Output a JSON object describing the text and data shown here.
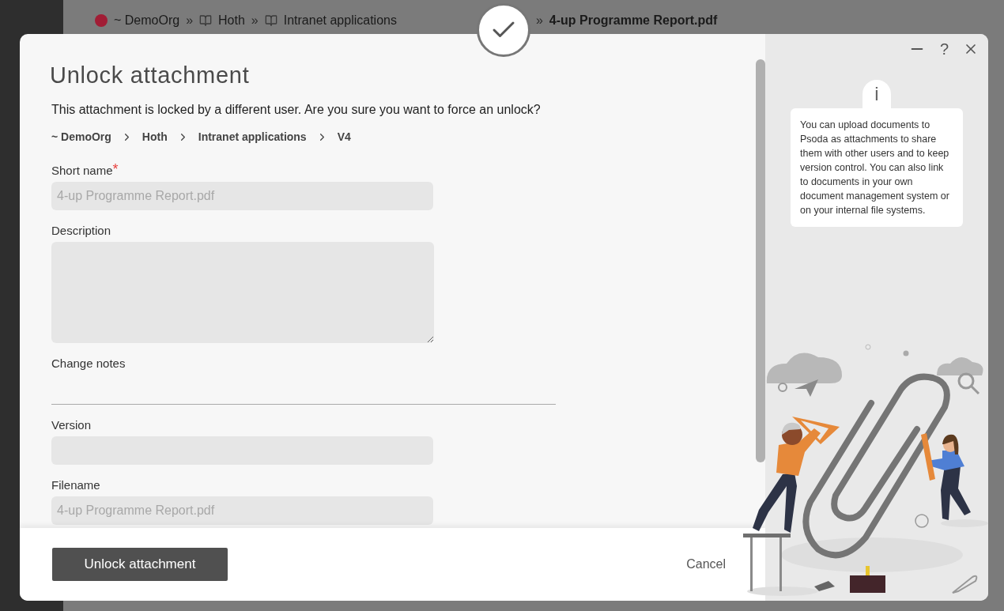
{
  "background": {
    "breadcrumb": [
      {
        "kind": "org",
        "label": "~ DemoOrg",
        "current": false
      },
      {
        "kind": "book",
        "label": "Hoth",
        "current": false
      },
      {
        "kind": "book",
        "label": "Intranet applications",
        "current": false
      },
      {
        "kind": "file",
        "label": "4-up Programme Report.pdf",
        "current": true
      }
    ],
    "separator": "»"
  },
  "dialog": {
    "title": "Unlock attachment",
    "message": "This attachment is locked by a different user. Are you sure you want to force an unlock?",
    "path": [
      "~ DemoOrg",
      "Hoth",
      "Intranet applications",
      "V4"
    ],
    "fields": [
      {
        "kind": "text",
        "label": "Short name",
        "required_mark": "*",
        "value": "4-up Programme Report.pdf",
        "disabled": true
      },
      {
        "kind": "textarea",
        "label": "Description",
        "disabled": true
      },
      {
        "kind": "underline",
        "label": "Change notes"
      },
      {
        "kind": "text",
        "label": "Version",
        "disabled": true
      },
      {
        "kind": "text",
        "label": "Filename",
        "value": "4-up Programme Report.pdf",
        "disabled": true
      }
    ],
    "primary_button": "Unlock attachment",
    "cancel_button": "Cancel",
    "help_label": "?",
    "info": {
      "badge": "i",
      "text": "You can upload documents to Psoda as attachments to share them with other users and to keep version control. You can also link to documents in your own document management system or on your internal file systems."
    }
  }
}
